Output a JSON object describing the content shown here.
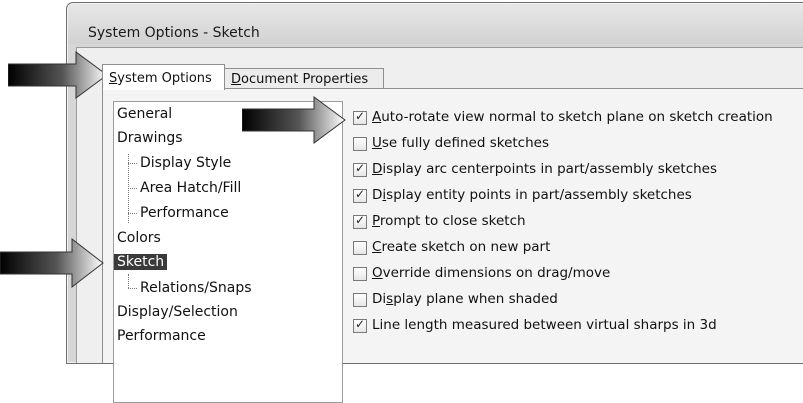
{
  "window": {
    "title": "System Options - Sketch"
  },
  "tabs": [
    {
      "label_accel": "S",
      "label_rest": "ystem Options",
      "active": true
    },
    {
      "label_accel": "D",
      "label_rest": "ocument Properties",
      "active": false
    }
  ],
  "tree": {
    "items": [
      {
        "label": "General",
        "level": 0
      },
      {
        "label": "Drawings",
        "level": 0
      },
      {
        "label": "Display Style",
        "level": 1
      },
      {
        "label": "Area Hatch/Fill",
        "level": 1
      },
      {
        "label": "Performance",
        "level": 1
      },
      {
        "label": "Colors",
        "level": 0
      },
      {
        "label": "Sketch",
        "level": 0,
        "selected": true
      },
      {
        "label": "Relations/Snaps",
        "level": 1
      },
      {
        "label": "Display/Selection",
        "level": 0
      },
      {
        "label": "Performance",
        "level": 0
      }
    ]
  },
  "options": [
    {
      "pre": "",
      "accel": "A",
      "post": "uto-rotate view normal to sketch plane on sketch creation",
      "checked": true
    },
    {
      "pre": "",
      "accel": "U",
      "post": "se fully defined sketches",
      "checked": false
    },
    {
      "pre": "",
      "accel": "D",
      "post": "isplay arc centerpoints in part/assembly sketches",
      "checked": true
    },
    {
      "pre": "D",
      "accel": "i",
      "post": "splay entity points in part/assembly sketches",
      "checked": true
    },
    {
      "pre": "",
      "accel": "P",
      "post": "rompt to close sketch",
      "checked": true
    },
    {
      "pre": "",
      "accel": "C",
      "post": "reate sketch on new part",
      "checked": false
    },
    {
      "pre": "",
      "accel": "O",
      "post": "verride dimensions on drag/move",
      "checked": false
    },
    {
      "pre": "Di",
      "accel": "s",
      "post": "play plane when shaded",
      "checked": false
    },
    {
      "pre": "",
      "accel": "",
      "post": "Line length measured between virtual sharps in 3d",
      "checked": true
    }
  ],
  "icons": {
    "callout_arrow": "callout-arrow-icon",
    "check": "checkmark-icon"
  },
  "colors": {
    "selected_bg": "#3a3a3a",
    "window_bg": "#d6d6d6"
  }
}
